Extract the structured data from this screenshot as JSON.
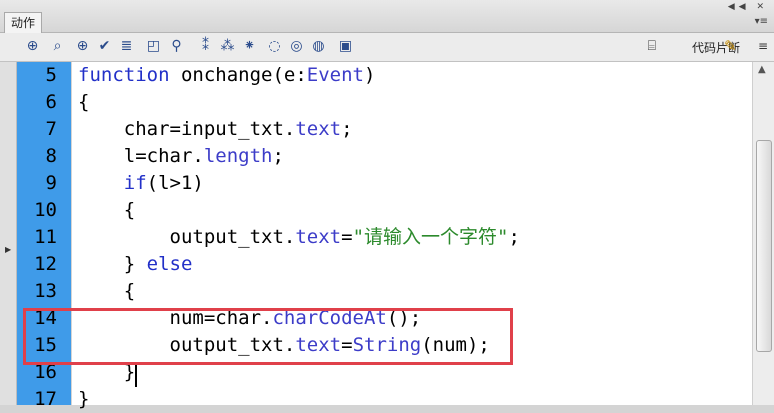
{
  "window": {
    "tab_title": "动作",
    "controls": "◀◀ ✕",
    "panel_menu": "▾≡"
  },
  "toolbar": {
    "icons": [
      "add-statement-icon",
      "find-icon",
      "target-path-icon",
      "check-syntax-icon",
      "auto-format-icon",
      "code-hint-icon",
      "debug-options-icon",
      "collapse-braces-icon",
      "collapse-selection-icon",
      "expand-all-icon",
      "apply-block-comment-icon",
      "apply-line-comment-icon",
      "remove-comment-icon",
      "show-hide-toolbox-icon"
    ],
    "snippets_label": "代码片断"
  },
  "code": {
    "lines": [
      {
        "n": "5",
        "tokens": [
          [
            "kw",
            "function"
          ],
          [
            "pl",
            " onchange(e:"
          ],
          [
            "ty",
            "Event"
          ],
          [
            "pl",
            ")"
          ]
        ]
      },
      {
        "n": "6",
        "tokens": [
          [
            "pl",
            "{"
          ]
        ]
      },
      {
        "n": "7",
        "tokens": [
          [
            "pl",
            "    char=input_txt."
          ],
          [
            "ty",
            "text"
          ],
          [
            "pl",
            ";"
          ]
        ]
      },
      {
        "n": "8",
        "tokens": [
          [
            "pl",
            "    l=char."
          ],
          [
            "ty",
            "length"
          ],
          [
            "pl",
            ";"
          ]
        ]
      },
      {
        "n": "9",
        "tokens": [
          [
            "pl",
            "    "
          ],
          [
            "kw",
            "if"
          ],
          [
            "pl",
            "(l>1)"
          ]
        ]
      },
      {
        "n": "10",
        "tokens": [
          [
            "pl",
            "    {"
          ]
        ]
      },
      {
        "n": "11",
        "tokens": [
          [
            "pl",
            "        output_txt."
          ],
          [
            "ty",
            "text"
          ],
          [
            "pl",
            "="
          ],
          [
            "str",
            "\"请输入一个字符\""
          ],
          [
            "pl",
            ";"
          ]
        ]
      },
      {
        "n": "12",
        "tokens": [
          [
            "pl",
            "    } "
          ],
          [
            "kw",
            "else"
          ]
        ]
      },
      {
        "n": "13",
        "tokens": [
          [
            "pl",
            "    {"
          ]
        ]
      },
      {
        "n": "14",
        "tokens": [
          [
            "pl",
            "        num=char."
          ],
          [
            "ty",
            "charCodeAt"
          ],
          [
            "pl",
            "();"
          ]
        ]
      },
      {
        "n": "15",
        "tokens": [
          [
            "pl",
            "        output_txt."
          ],
          [
            "ty",
            "text"
          ],
          [
            "pl",
            "="
          ],
          [
            "ty",
            "String"
          ],
          [
            "pl",
            "(num);"
          ]
        ]
      },
      {
        "n": "16",
        "tokens": [
          [
            "pl",
            "    }"
          ]
        ]
      },
      {
        "n": "17",
        "tokens": [
          [
            "pl",
            "}"
          ]
        ]
      }
    ]
  }
}
